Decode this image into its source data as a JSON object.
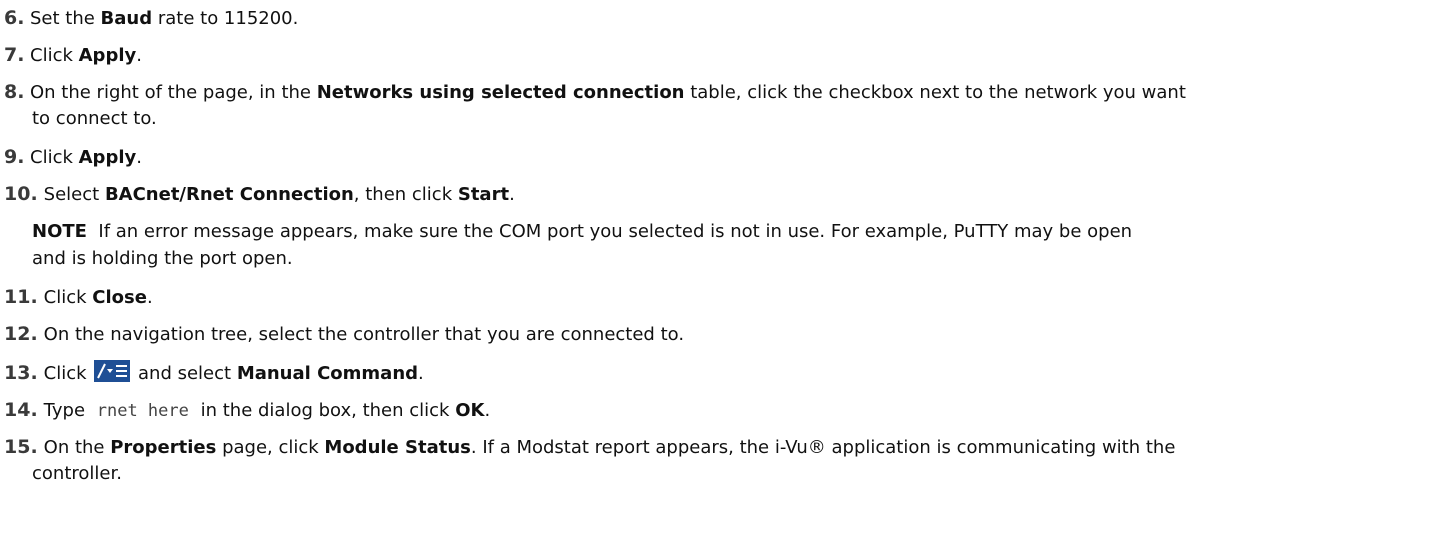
{
  "steps": {
    "s6": {
      "num": "6.",
      "a": "Set the ",
      "b1": "Baud",
      "c": " rate to 115200."
    },
    "s7": {
      "num": "7.",
      "a": "Click ",
      "b1": "Apply",
      "c": "."
    },
    "s8": {
      "num": "8.",
      "a": "On the right of the page, in the ",
      "b1": "Networks using selected connection",
      "c": " table, click the checkbox next to the network you want",
      "line2": "to connect to."
    },
    "s9": {
      "num": "9.",
      "a": "Click ",
      "b1": "Apply",
      "c": "."
    },
    "s10": {
      "num": "10.",
      "a": "Select ",
      "b1": "BACnet/Rnet Connection",
      "c": ", then click ",
      "b2": "Start",
      "d": ".",
      "note_label": "NOTE",
      "note_text": "  If an error message appears, make sure the COM port you selected is not in use. For example, PuTTY may be open",
      "note_line2": "and is holding the port open."
    },
    "s11": {
      "num": "11.",
      "a": "Click ",
      "b1": "Close",
      "c": "."
    },
    "s12": {
      "num": "12.",
      "a": "On the navigation tree, select the controller that you are connected to."
    },
    "s13": {
      "num": "13.",
      "a": "Click ",
      "c": " and select ",
      "b1": "Manual Command",
      "d": "."
    },
    "s14": {
      "num": "14.",
      "a": "Type ",
      "code": "rnet here",
      "c": " in the dialog box, then click ",
      "b1": "OK",
      "d": "."
    },
    "s15": {
      "num": "15.",
      "a": "On the ",
      "b1": "Properties",
      "c": " page, click ",
      "b2": "Module Status",
      "d": ". If a Modstat report appears, the i-Vu® application is communicating with the",
      "line2": "controller."
    }
  },
  "icons": {
    "manual_command_icon": "edit-menu-icon",
    "icon_color": "#1f4f95"
  }
}
